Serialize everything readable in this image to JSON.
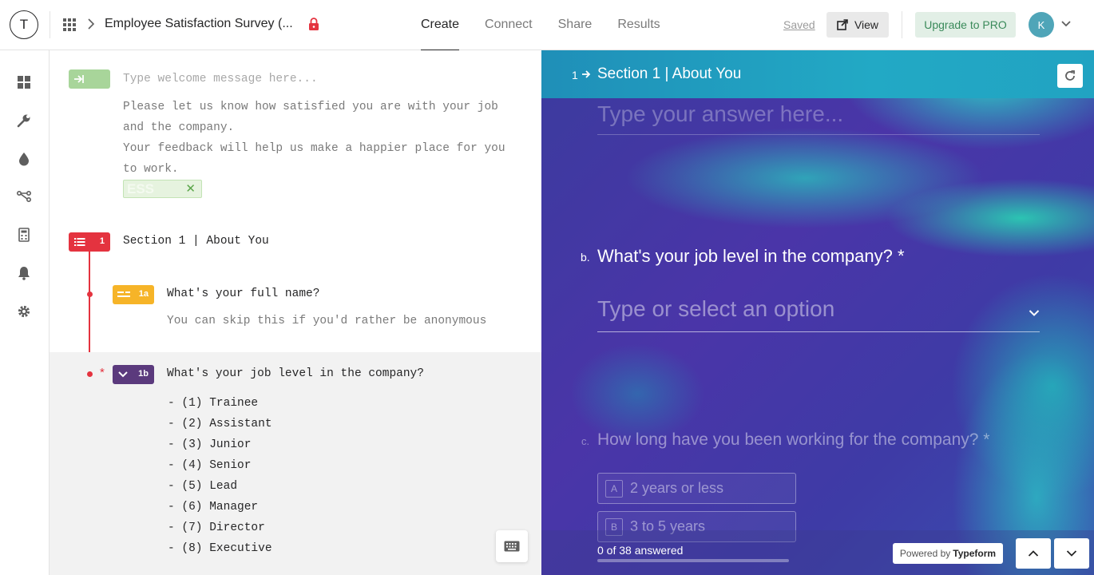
{
  "app": {
    "logo_letter": "T",
    "form_title": "Employee Satisfaction Survey (...",
    "tabs": [
      {
        "label": "Create",
        "active": true
      },
      {
        "label": "Connect",
        "active": false
      },
      {
        "label": "Share",
        "active": false
      },
      {
        "label": "Results",
        "active": false
      }
    ],
    "saved_label": "Saved",
    "view_label": "View",
    "upgrade_label": "Upgrade to PRO",
    "avatar_letter": "K"
  },
  "sidebar": {
    "icons": [
      "dashboard-icon",
      "wrench-icon",
      "drop-icon",
      "logic-icon",
      "calculator-icon",
      "bell-icon",
      "gear-icon"
    ]
  },
  "editor": {
    "welcome": {
      "placeholder": "Type welcome message here...",
      "description": [
        "Please let us know how satisfied you are with your job",
        "and the company.",
        "Your feedback will help us make a happier place for you",
        "to work."
      ],
      "tag": "ESS"
    },
    "section": {
      "number": "1",
      "title": "Section 1 | About You"
    },
    "question_1a": {
      "number": "1a",
      "title": "What's your full name?",
      "description": "You can skip this if you'd rather be anonymous"
    },
    "question_1b": {
      "number": "1b",
      "required_mark": "*",
      "title": "What's your job level in the company?",
      "options": [
        "- (1) Trainee",
        "- (2) Assistant",
        "- (3) Junior",
        "- (4) Senior",
        "- (5) Lead",
        "- (6) Manager",
        "- (7) Director",
        "- (8) Executive"
      ]
    }
  },
  "preview": {
    "header": {
      "number": "1",
      "title": "Section 1 | About You"
    },
    "previous_answer_placeholder": "Type your answer here...",
    "question_b": {
      "letter": "b.",
      "title": "What's your job level in the company? *",
      "input_placeholder": "Type or select an option"
    },
    "question_c": {
      "letter": "c.",
      "title": "How long have you been working for the company? *",
      "choices": [
        {
          "key": "A",
          "label": "2 years or less"
        },
        {
          "key": "B",
          "label": "3 to 5 years"
        }
      ]
    },
    "progress": {
      "text": "0 of 38 answered",
      "answered": 0,
      "total": 38
    },
    "powered_by_prefix": "Powered by",
    "powered_by_brand": "Typeform"
  },
  "colors": {
    "section_red": "#e4333f",
    "welcome_green": "#a8d59a",
    "short_text_yellow": "#f6b428",
    "dropdown_purple": "#5b3a7d",
    "upgrade_green": "#3a8a5a"
  }
}
